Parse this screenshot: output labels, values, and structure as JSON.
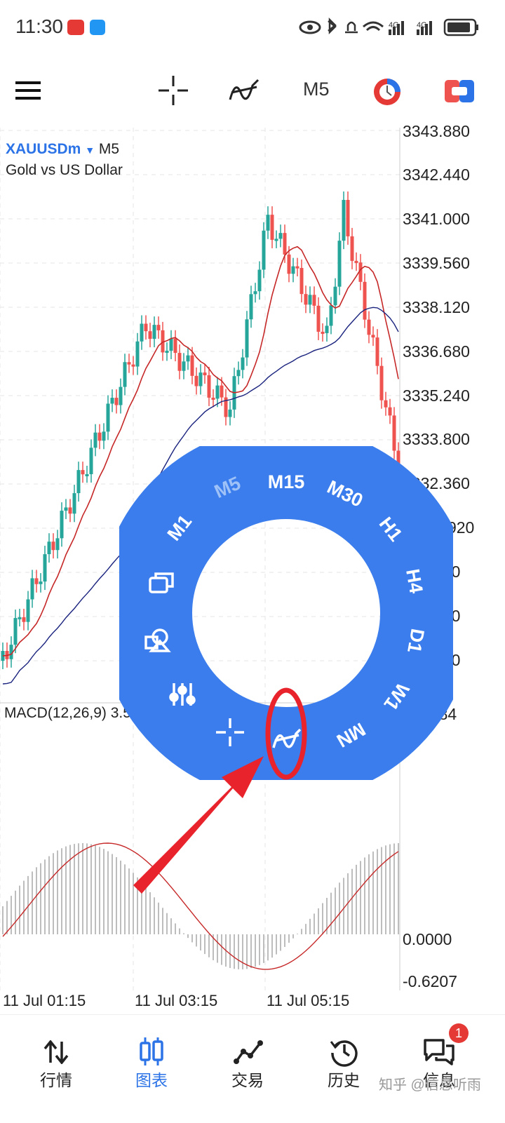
{
  "status_bar": {
    "time": "11:30"
  },
  "toolbar": {
    "timeframe": "M5"
  },
  "chart": {
    "symbol": "XAUUSDm",
    "symbol_timeframe": "M5",
    "description": "Gold vs US Dollar",
    "price_levels": [
      "3343.880",
      "3342.440",
      "3341.000",
      "3339.560",
      "3338.120",
      "3336.680",
      "3335.240",
      "3333.800",
      "3332.360",
      "30.920",
      "480",
      "040",
      "600"
    ],
    "macd_label": "MACD(12,26,9) 3.59",
    "macd_levels": [
      "7984",
      "0.0000",
      "-0.6207"
    ],
    "time_labels": [
      "11 Jul 01:15",
      "11 Jul 03:15",
      "11 Jul 05:15"
    ]
  },
  "ring_menu": {
    "items": [
      "M1",
      "M5",
      "M15",
      "M30",
      "H1",
      "H4",
      "D1",
      "W1",
      "MN"
    ],
    "active": "M5"
  },
  "bottom_nav": {
    "items": [
      {
        "label": "行情",
        "icon": "quotes-arrows-icon"
      },
      {
        "label": "图表",
        "icon": "chart-candles-icon"
      },
      {
        "label": "交易",
        "icon": "trade-icon"
      },
      {
        "label": "历史",
        "icon": "history-icon"
      },
      {
        "label": "信息",
        "icon": "messages-icon"
      }
    ],
    "active_index": 1,
    "badge": "1"
  },
  "watermark": "知乎 @信息听雨",
  "colors": {
    "accent": "#2b73e6",
    "ring": "#3b7ded",
    "up": "#26a69a",
    "down": "#ef5350",
    "annotation": "#e8232c"
  }
}
